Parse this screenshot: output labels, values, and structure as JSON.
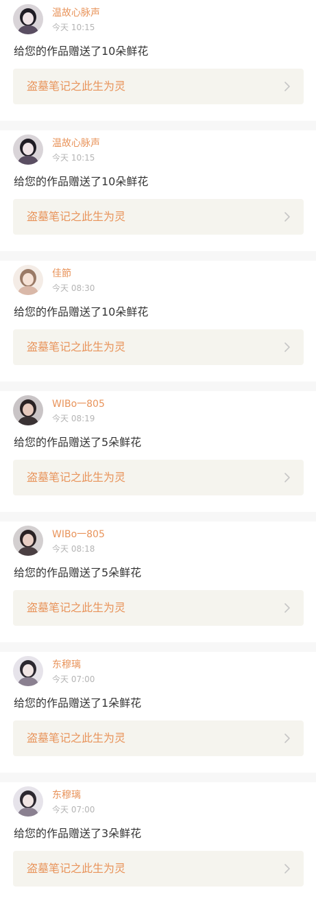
{
  "notifications": [
    {
      "username": "温故心脉声",
      "time": "今天 10:15",
      "message": "给您的作品赠送了10朵鲜花",
      "work_title": "盗墓笔记之此生为灵",
      "avatar": {
        "bg": "#d9d4d8",
        "hair": "#1f1c24",
        "skin": "#efe3e6",
        "cloth": "#5a4e62"
      }
    },
    {
      "username": "温故心脉声",
      "time": "今天 10:15",
      "message": "给您的作品赠送了10朵鲜花",
      "work_title": "盗墓笔记之此生为灵",
      "avatar": {
        "bg": "#d9d4d8",
        "hair": "#1f1c24",
        "skin": "#efe3e6",
        "cloth": "#5a4e62"
      }
    },
    {
      "username": "佳節",
      "time": "今天 08:30",
      "message": "给您的作品赠送了10朵鲜花",
      "work_title": "盗墓笔记之此生为灵",
      "avatar": {
        "bg": "#f4ece6",
        "hair": "#9a7a66",
        "skin": "#f6e2d6",
        "cloth": "#d9b8a8"
      }
    },
    {
      "username": "WIBo一805",
      "time": "今天 08:19",
      "message": "给您的作品赠送了5朵鲜花",
      "work_title": "盗墓笔记之此生为灵",
      "avatar": {
        "bg": "#c9c4c6",
        "hair": "#2a2224",
        "skin": "#e6c9bd",
        "cloth": "#3a3234"
      }
    },
    {
      "username": "WIBo一805",
      "time": "今天 08:18",
      "message": "给您的作品赠送了5朵鲜花",
      "work_title": "盗墓笔记之此生为灵",
      "avatar": {
        "bg": "#d3cfd0",
        "hair": "#2a2224",
        "skin": "#e8cec4",
        "cloth": "#4a3f42"
      }
    },
    {
      "username": "东穆璃",
      "time": "今天 07:00",
      "message": "给您的作品赠送了1朵鲜花",
      "work_title": "盗墓笔记之此生为灵",
      "avatar": {
        "bg": "#e6e3ea",
        "hair": "#2c2830",
        "skin": "#f1e5e4",
        "cloth": "#8a8090"
      }
    },
    {
      "username": "东穆璃",
      "time": "今天 07:00",
      "message": "给您的作品赠送了3朵鲜花",
      "work_title": "盗墓笔记之此生为灵",
      "avatar": {
        "bg": "#e6e3ea",
        "hair": "#2c2830",
        "skin": "#f1e5e4",
        "cloth": "#8a8090"
      }
    }
  ],
  "colors": {
    "accent": "#e8935a",
    "card_bg": "#ffffff",
    "link_bg": "#f5f4ee",
    "separator": "#f7f7f7",
    "text": "#333333",
    "time": "#b4b4b4",
    "chevron": "#c6c6c6"
  },
  "icons": {
    "link_chevron": "chevron-right-icon",
    "avatar": "avatar-icon"
  }
}
